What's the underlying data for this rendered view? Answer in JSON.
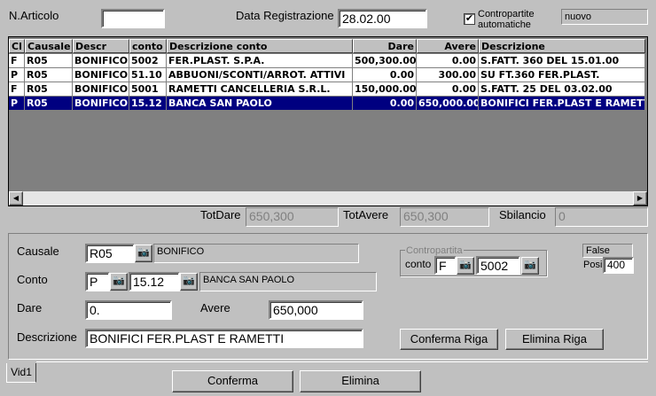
{
  "header": {
    "articolo_label": "N.Articolo",
    "articolo_value": "",
    "data_label": "Data Registrazione",
    "data_value": "28.02.00",
    "contropartite_label_1": "Contropartite",
    "contropartite_label_2": "automatiche",
    "contropartite_checked": true,
    "status_value": "nuovo"
  },
  "grid": {
    "columns": [
      "Cl",
      "Causale",
      "Descr",
      "conto",
      "Descrizione conto",
      "Dare",
      "Avere",
      "Descrizione"
    ],
    "rows": [
      [
        "F",
        "R05",
        "BONIFICO",
        "5002",
        "FER.PLAST. S.P.A.",
        "500,300.00",
        "0.00",
        "S.FATT. 360 DEL 15.01.00"
      ],
      [
        "P",
        "R05",
        "BONIFICO",
        "51.10",
        "ABBUONI/SCONTI/ARROT. ATTIVI",
        "0.00",
        "300.00",
        "SU FT.360 FER.PLAST."
      ],
      [
        "F",
        "R05",
        "BONIFICO",
        "5001",
        "RAMETTI CANCELLERIA S.R.L.",
        "150,000.00",
        "0.00",
        "S.FATT. 25 DEL 03.02.00"
      ],
      [
        "P",
        "R05",
        "BONIFICO",
        "15.12",
        "BANCA SAN PAOLO",
        "0.00",
        "650,000.00",
        "BONIFICI FER.PLAST E RAMETT"
      ]
    ],
    "selected_row": 3
  },
  "totals": {
    "totdare_label": "TotDare",
    "totdare_value": "650,300",
    "totavere_label": "TotAvere",
    "totavere_value": "650,300",
    "sbilancio_label": "Sbilancio",
    "sbilancio_value": "0"
  },
  "detail": {
    "causale_label": "Causale",
    "causale_code": "R05",
    "causale_desc": "BONIFICO",
    "conto_label": "Conto",
    "conto_type": "P",
    "conto_code": "15.12",
    "conto_desc": "BANCA SAN PAOLO",
    "dare_label": "Dare",
    "dare_value": "0.",
    "avere_label": "Avere",
    "avere_value": "650,000",
    "descrizione_label": "Descrizione",
    "descrizione_value": "BONIFICI FER.PLAST E RAMETTI",
    "contropartita_group_label": "Contropartita",
    "contropartita_conto_label": "conto",
    "contropartita_type": "F",
    "contropartita_code": "5002",
    "false_value": "False",
    "posi_label": "Posi",
    "posi_value": "400",
    "conferma_riga_label": "Conferma Riga",
    "elimina_riga_label": "Elimina Riga"
  },
  "tabs": {
    "tab1_label": "Vid1"
  },
  "footer": {
    "conferma_label": "Conferma",
    "elimina_label": "Elimina"
  },
  "icons": {
    "camera": "camera-icon",
    "check": "checkmark-icon",
    "left": "left-arrow-icon",
    "right": "right-arrow-icon"
  }
}
